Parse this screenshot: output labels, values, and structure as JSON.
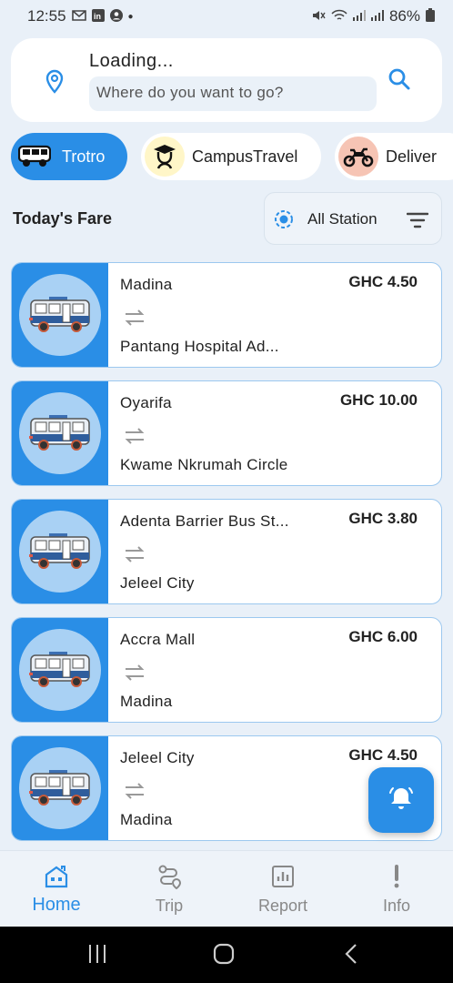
{
  "status_bar": {
    "time": "12:55",
    "battery": "86%",
    "left_icons": [
      "gmail-icon",
      "linkedin-icon",
      "account-icon",
      "dot-icon"
    ],
    "right_icons": [
      "mute-icon",
      "wifi-icon",
      "signal-icon",
      "signal-icon",
      "battery-icon"
    ]
  },
  "search": {
    "title": "Loading...",
    "placeholder": "Where do you want to go?"
  },
  "categories": [
    {
      "label": "Trotro",
      "icon": "bus-icon",
      "active": true
    },
    {
      "label": "CampusTravel",
      "icon": "graduate-icon",
      "active": false
    },
    {
      "label": "Deliver",
      "icon": "motorbike-icon",
      "active": false
    }
  ],
  "fares_header": {
    "title": "Today's Fare",
    "station_filter": "All Station"
  },
  "fares": [
    {
      "from": "Madina",
      "to": "Pantang Hospital Ad...",
      "price": "GHC 4.50"
    },
    {
      "from": "Oyarifa",
      "to": "Kwame Nkrumah Circle",
      "price": "GHC 10.00"
    },
    {
      "from": "Adenta Barrier Bus St...",
      "to": "Jeleel City",
      "price": "GHC 3.80"
    },
    {
      "from": "Accra Mall",
      "to": "Madina",
      "price": "GHC 6.00"
    },
    {
      "from": "Jeleel City",
      "to": "Madina",
      "price": "GHC 4.50"
    }
  ],
  "bottom_nav": [
    {
      "label": "Home",
      "icon": "home-icon",
      "active": true
    },
    {
      "label": "Trip",
      "icon": "route-icon",
      "active": false
    },
    {
      "label": "Report",
      "icon": "report-icon",
      "active": false
    },
    {
      "label": "Info",
      "icon": "info-icon",
      "active": false
    }
  ],
  "colors": {
    "accent": "#2a8ee6",
    "background": "#e9f0f8",
    "card_border": "#9cc8ef"
  }
}
